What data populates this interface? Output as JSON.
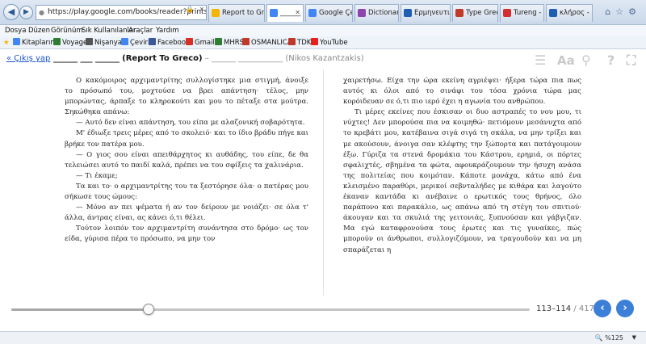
{
  "browser": {
    "address": "https://play.google.com/books/reader?printsec=fr",
    "tabs": [
      {
        "label": "Report to Gr...",
        "color": "#f4b400"
      },
      {
        "label": "______ ___...",
        "color": "#4285f4",
        "active": true
      },
      {
        "label": "Google Çeviri",
        "color": "#4285f4"
      },
      {
        "label": "Dictionary o...",
        "color": "#8e44ad"
      },
      {
        "label": "Ερμηνευτικ...",
        "color": "#1e5fb4"
      },
      {
        "label": "Type Greek I...",
        "color": "#c0392b"
      },
      {
        "label": "Tureng - lot...",
        "color": "#d32f2f"
      },
      {
        "label": "κλήρος - Συ...",
        "color": "#1e5fb4"
      }
    ]
  },
  "menu": [
    "Dosya",
    "Düzen",
    "Görünüm",
    "Sık Kullanılanlar",
    "Araçlar",
    "Yardım"
  ],
  "favorites": [
    {
      "label": "Kitaplarım",
      "color": "#4285f4"
    },
    {
      "label": "Voyage",
      "color": "#2e7d32"
    },
    {
      "label": "Nişanyan",
      "color": "#555555"
    },
    {
      "label": "Çeviri",
      "color": "#4285f4"
    },
    {
      "label": "Facebook",
      "color": "#3b5998"
    },
    {
      "label": "Gmail",
      "color": "#d93025"
    },
    {
      "label": "MHRS",
      "color": "#2e7d32"
    },
    {
      "label": "OSMANLICA",
      "color": "#c0392b"
    },
    {
      "label": "TDK",
      "color": "#c0392b"
    },
    {
      "label": "YouTube",
      "color": "#e62117"
    }
  ],
  "header": {
    "back_link": "« Çıkış yap",
    "title_blanks": "______ ___ ______",
    "title": "(Report To Greco)",
    "dash": "–",
    "author_blanks": "______ ___________",
    "author": "(Nikos Kazantzakis)"
  },
  "pages": {
    "left": [
      "Ο κακόμοιρος αρχιμαντρίτης συλλογίστηκε μια στιγμή, άνοιξε το πρόσωπό του, μοχτούσε να βρει απάντηση· τέλος, μην μπορώντας, άρπαξε το κληροκούτι και μου το πέταξε στα μούτρα. Σηκώθηκα απάνω:",
      "— Αυτό δεν είναι απάντηση, του είπα με αλαζονική σοβαρότητα.",
      "Μ' έδιωξε τρεις μέρες από το σκολειό· και το ίδιο βράδυ πήγε και βρήκε τον πατέρα μου.",
      "— Ο γιος σου είναι απειθάρχητος κι αυθάδης, του είπε, δε θα τελειώσει αυτό το παιδί καλά, πρέπει να του σφίξεις τα χαλινάρια.",
      "— Τι έκαμε;",
      "Τα και το· ο αρχιμαντρίτης του τα ξεστόρησε όλα· ο πατέρας μου σήκωσε τους ώμους:",
      "— Μόνο αν πει ψέματα ή αν τον δείρουν με νοιάζει· σε όλα τ' άλλα, άντρας είναι, ας κάνει ό,τι θέλει.",
      "Τούτον λοιπόν τον αρχιμαντρίτη συνάντησα στο δρόμο· ως τον είδα, γύρισα πέρα το πρόσωπο, να μην τον"
    ],
    "right": [
      "χαιρετήσω. Είχα την ώρα εκείνη αγριέψει· ήξερα τώρα πια πως αυτός κι όλοι από το σινάφι του τόσα χρόνια τώρα μας κορόιδευαν σε ό,τι πιο ιερό έχει η αγωνία του ανθρώπου.",
      "Τι μέρες εκείνες που έσκισαν οι δυο αστραπές το νου μου, τι νύχτες! Δεν μπορούσα πια να κοιμηθώ· πετιόμουν μεσάνυχτα από το κρεβάτι μου, κατέβαινα σιγά σιγά τη σκάλα, να μην τρίξει και με ακούσουν, άνοιγα σαν κλέφτης την ξώπορτα και πατάγουμουν έξω. Γύριζα τα στενά δρομάκια του Κάστρου, ερημιά, οι πόρτες σφαλιχτές, σβημένα τα φώτα, αφουκράζουμουν την ήσυχη ανάσα της πολιτείας που κοιμόταν. Κάποτε μονάχα, κάτω από ένα κλεισμένο παραθύρι, μερικοί σεβνταλήδες με κιθάρα και λαγούτο έκαναν καντάδα κι ανέβαινε ο ερωτικός τους θρήνος, όλο παράπονο και παρακάλιο, ως απάνω από τη στέγη του σπιτιού· άκουγαν και τα σκυλιά της γειτονιάς, ξυπνούσαν και γάβγιζαν. Μα εγώ καταφρονούσα τους έρωτες και τις γυναίκες, πώς μπορούν οι άνθρωποι, συλλογιζόμουν, να τραγουδούν και να μη σπαράζεται η"
    ]
  },
  "nav": {
    "page_range": "113–114",
    "page_total": "/ 417",
    "progress": 0.265
  },
  "status": {
    "zoom": "%125"
  },
  "colors": {
    "link": "#1a55c8",
    "nav_button": "#3b7fd8"
  }
}
